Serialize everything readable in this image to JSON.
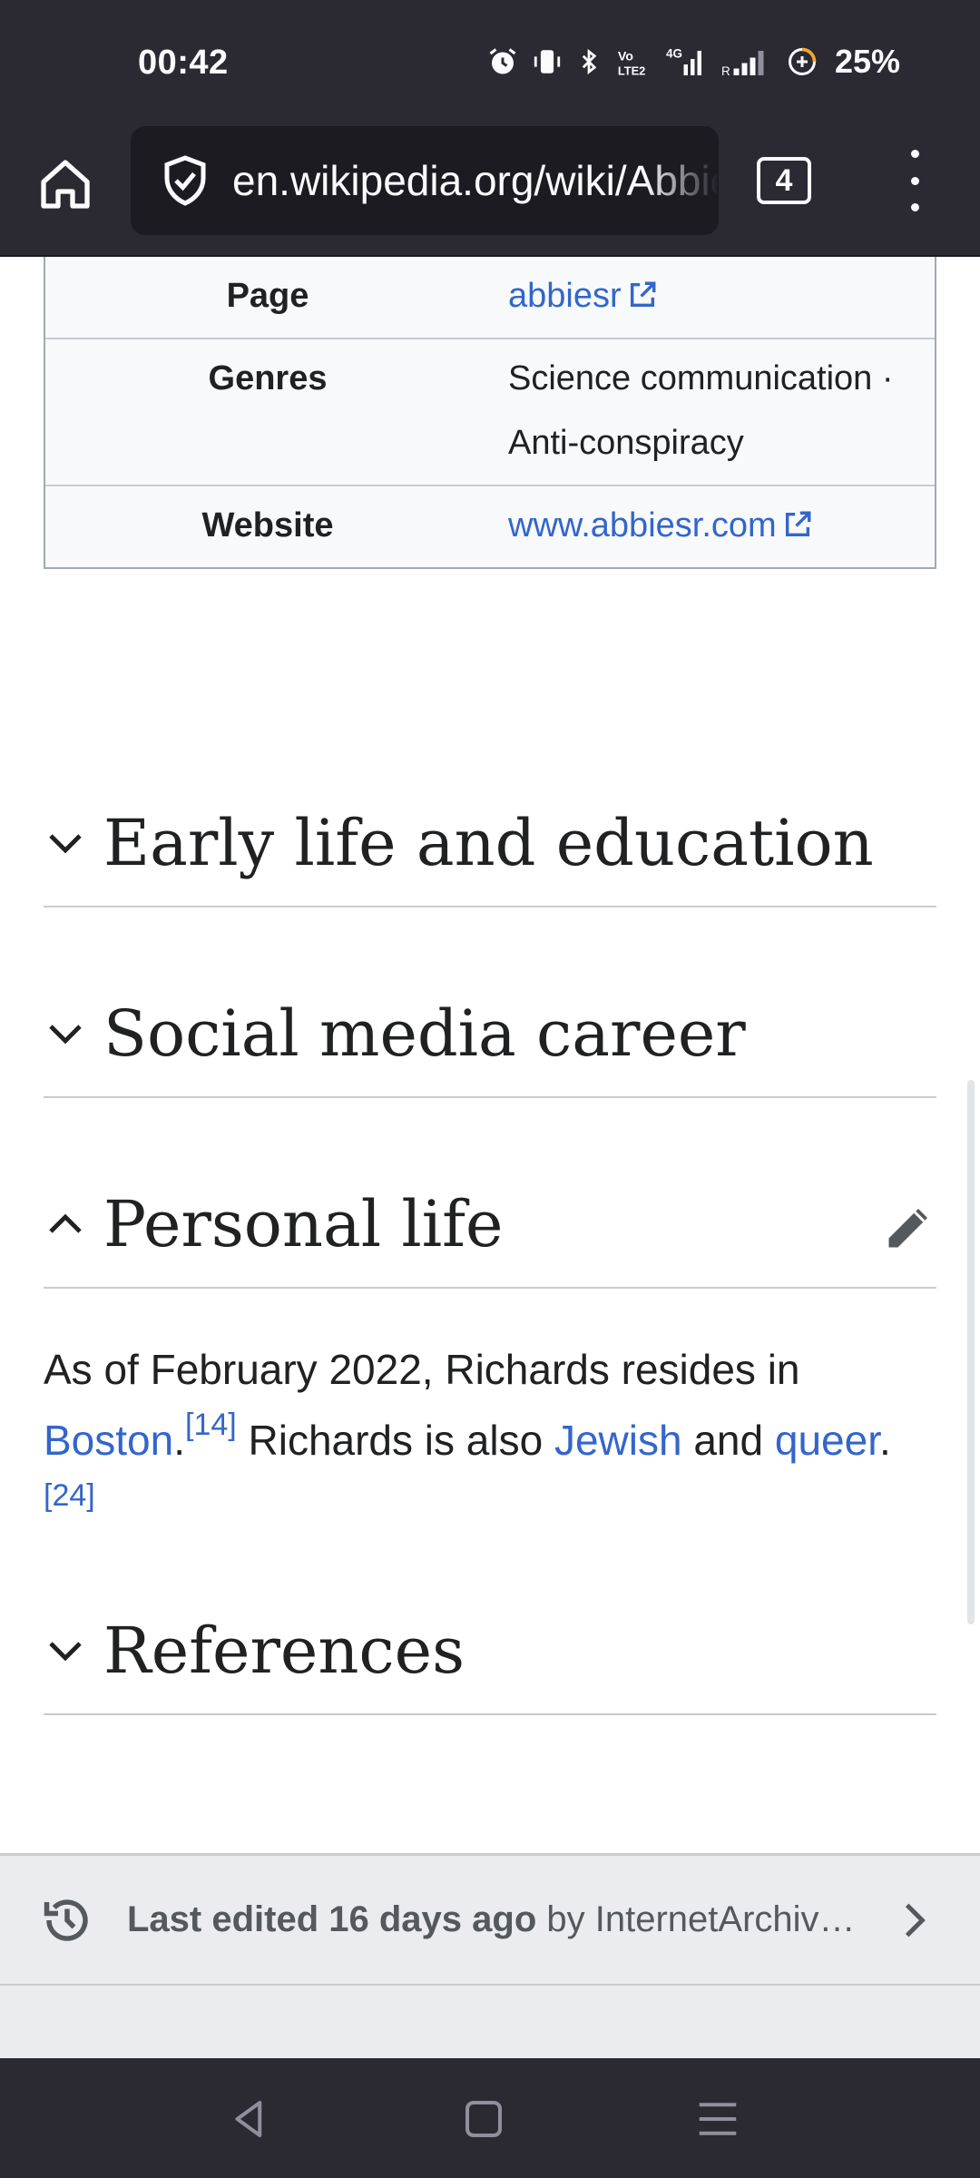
{
  "status_bar": {
    "time": "00:42",
    "battery": "25%"
  },
  "browser": {
    "url": "en.wikipedia.org/wiki/Abbie_Richards",
    "tab_count": "4"
  },
  "infobox": {
    "rows": [
      {
        "label": "Page",
        "value": "abbiesr",
        "is_link": true
      },
      {
        "label": "Genres",
        "value": "Science communication · Anti-conspiracy",
        "is_link": false
      },
      {
        "label": "Website",
        "value": "www.abbiesr.com",
        "is_link": true
      }
    ]
  },
  "sections": {
    "early_life": "Early life and education",
    "social_media": "Social media career",
    "personal_life": "Personal life",
    "references": "References"
  },
  "personal_life_text": {
    "part1": "As of February 2022, Richards resides in ",
    "boston": "Boston",
    "period1": ".",
    "ref14": "[14]",
    "part2": " Richards is also ",
    "jewish": "Jewish",
    "and": " and ",
    "queer": "queer",
    "period2": ".",
    "ref24": "[24]"
  },
  "footer": {
    "last_edited": "Last edited 16 days ago",
    "by": " by InternetArchiveBot"
  },
  "colors": {
    "link": "#3366cc",
    "chrome_dark": "#2b2a33",
    "footer_bg": "#eaecf0"
  }
}
